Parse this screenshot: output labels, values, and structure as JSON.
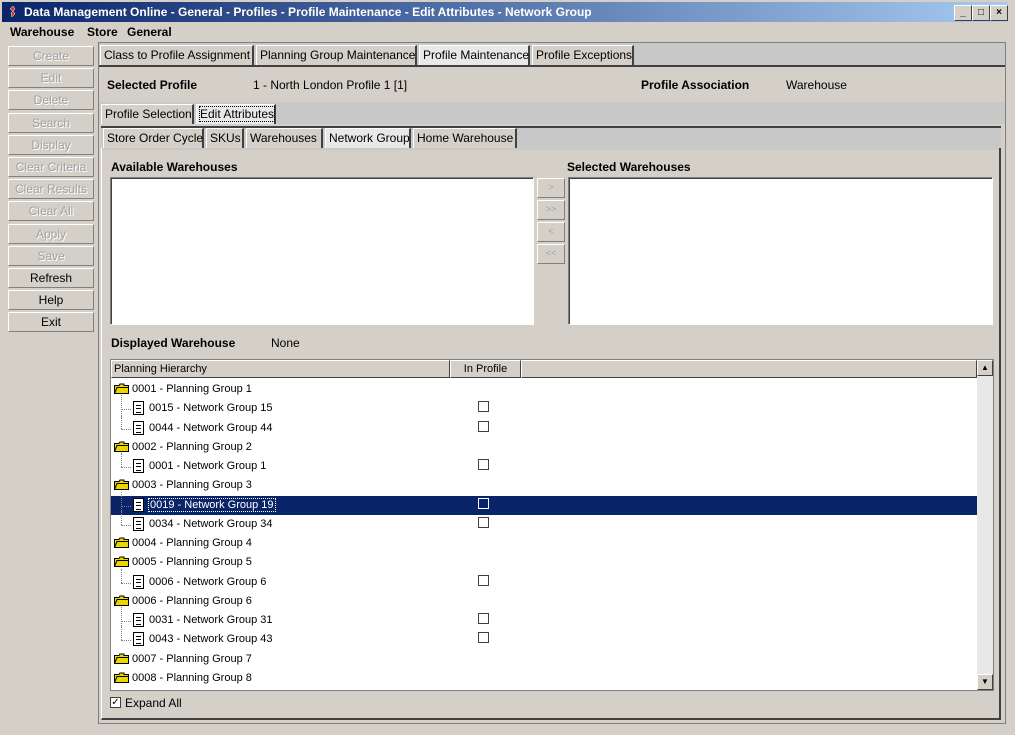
{
  "window": {
    "title": "Data Management Online - General - Profiles - Profile Maintenance - Edit Attributes - Network Group",
    "controls": [
      "_",
      "□",
      "×"
    ]
  },
  "menu": [
    "Warehouse",
    "Store",
    "General"
  ],
  "left_buttons": [
    {
      "label": "Create",
      "enabled": false
    },
    {
      "label": "Edit",
      "enabled": false
    },
    {
      "label": "Delete",
      "enabled": false
    },
    {
      "label": "Search",
      "enabled": false
    },
    {
      "label": "Display",
      "enabled": false
    },
    {
      "label": "Clear Criteria",
      "enabled": false
    },
    {
      "label": "Clear Results",
      "enabled": false
    },
    {
      "label": "Clear All",
      "enabled": false
    },
    {
      "label": "Apply",
      "enabled": false
    },
    {
      "label": "Save",
      "enabled": false
    },
    {
      "label": "Refresh",
      "enabled": true
    },
    {
      "label": "Help",
      "enabled": true
    },
    {
      "label": "Exit",
      "enabled": true
    }
  ],
  "top_tabs": [
    "Class to Profile Assignment",
    "Planning Group Maintenance",
    "Profile Maintenance",
    "Profile Exceptions"
  ],
  "top_tabs_active": "Profile Maintenance",
  "profile": {
    "selected_label": "Selected Profile",
    "selected_value": "1 - North London Profile 1 [1]",
    "association_label": "Profile Association",
    "association_value": "Warehouse"
  },
  "sub_tabs": [
    "Profile Selection",
    "Edit Attributes"
  ],
  "sub_tabs_active": "Edit Attributes",
  "attr_tabs": [
    "Store Order Cycle",
    "SKUs",
    "Warehouses",
    "Network Group",
    "Home Warehouse"
  ],
  "attr_tabs_active": "Network Group",
  "available_label": "Available Warehouses",
  "selected_label": "Selected Warehouses",
  "move_buttons": [
    ">",
    ">>",
    "<",
    "<<"
  ],
  "displayed_warehouse": {
    "label": "Displayed Warehouse",
    "value": "None"
  },
  "tree": {
    "columns": [
      "Planning Hierarchy",
      "In Profile"
    ],
    "rows": [
      {
        "level": 0,
        "text": "0001 - Planning Group 1"
      },
      {
        "level": 1,
        "text": "0015 - Network Group 15",
        "checked": false
      },
      {
        "level": 1,
        "text": "0044 - Network Group 44",
        "checked": false,
        "last": true
      },
      {
        "level": 0,
        "text": "0002 - Planning Group 2"
      },
      {
        "level": 1,
        "text": "0001 - Network Group 1",
        "checked": false,
        "last": true
      },
      {
        "level": 0,
        "text": "0003 - Planning Group 3"
      },
      {
        "level": 1,
        "text": "0019 - Network Group 19",
        "checked": false,
        "selected": true
      },
      {
        "level": 1,
        "text": "0034 - Network Group 34",
        "checked": false,
        "last": true
      },
      {
        "level": 0,
        "text": "0004 - Planning Group 4"
      },
      {
        "level": 0,
        "text": "0005 - Planning Group 5"
      },
      {
        "level": 1,
        "text": "0006 - Network Group 6",
        "checked": false,
        "last": true
      },
      {
        "level": 0,
        "text": "0006 - Planning Group 6"
      },
      {
        "level": 1,
        "text": "0031 - Network Group 31",
        "checked": false
      },
      {
        "level": 1,
        "text": "0043 - Network Group 43",
        "checked": false,
        "last": true
      },
      {
        "level": 0,
        "text": "0007 - Planning Group 7"
      },
      {
        "level": 0,
        "text": "0008 - Planning Group 8"
      }
    ]
  },
  "expand_all": {
    "label": "Expand All",
    "checked": true
  },
  "colors": {
    "selection": "#0a246a",
    "face": "#d4d0c8",
    "titlebar_start": "#0a246a",
    "titlebar_end": "#a6caf0"
  }
}
